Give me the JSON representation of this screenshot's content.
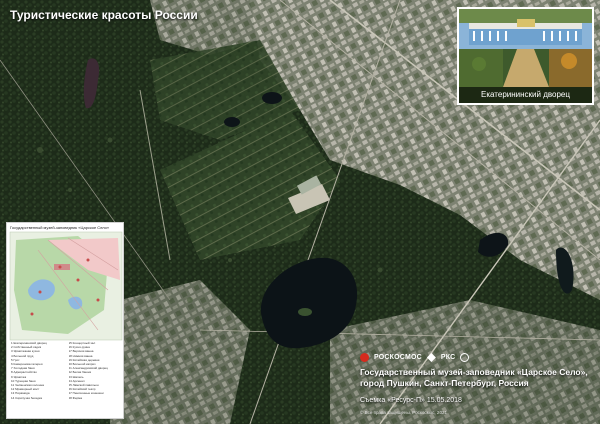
{
  "series_title": "Туристические красоты России",
  "photo_inset": {
    "caption": "Екатерининский дворец"
  },
  "plan_inset": {
    "title": "Государственный музей-заповедник «Царское Село»",
    "legend": [
      "1 Екатерининский дворец",
      "2 Собственный садик",
      "3 Эрмитажная кухня",
      "4 Большой пруд",
      "5 Грот",
      "6 Камеронова галерея",
      "7 Холодная баня",
      "8 Адмиралтейство",
      "9 Эрмитаж",
      "10 Турецкая баня",
      "11 Чесменская колонна",
      "12 Мраморный мост",
      "13 Пирамида",
      "14 Скрипучая беседка",
      "15 Концертный зал",
      "16 Кухня-руина",
      "17 Верхняя ванна",
      "18 Нижняя ванна",
      "19 Китайская деревня",
      "20 Большой каприз",
      "21 Александровский дворец",
      "22 Белая башня",
      "23 Шапель",
      "24 Арсенал",
      "25 Ламской павильон",
      "26 Китайский театр",
      "27 Пенсионные конюшни",
      "28 Ферма"
    ]
  },
  "brands": {
    "roscosmos": "РОСКОСМОС",
    "rkc": "РКС"
  },
  "caption": {
    "line1": "Государственный музей-заповедник «Царское Село»,",
    "line2": "город Пушкин, Санкт-Петербург, Россия"
  },
  "credit": "Съемка «Ресурс-П» 15.05.2018",
  "copyright": "© Все права защищены. Роскосмос, 2021",
  "colors": {
    "forest": "#1f2e1a",
    "urban": "#9a9a8e",
    "water": "#0d1418",
    "accent_red": "#d52b1e"
  }
}
